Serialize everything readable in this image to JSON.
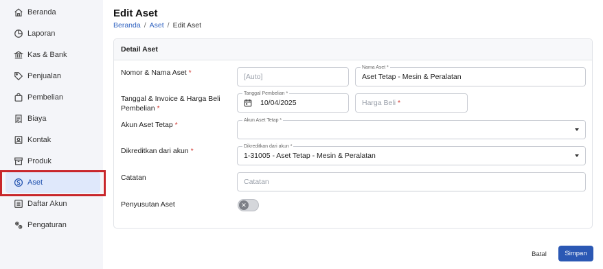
{
  "sidebar": {
    "items": [
      {
        "label": "Beranda",
        "icon": "home-icon"
      },
      {
        "label": "Laporan",
        "icon": "pie-chart-icon"
      },
      {
        "label": "Kas & Bank",
        "icon": "bank-icon"
      },
      {
        "label": "Penjualan",
        "icon": "tag-icon"
      },
      {
        "label": "Pembelian",
        "icon": "shopping-bag-icon"
      },
      {
        "label": "Biaya",
        "icon": "receipt-icon"
      },
      {
        "label": "Kontak",
        "icon": "contact-card-icon"
      },
      {
        "label": "Produk",
        "icon": "box-icon"
      },
      {
        "label": "Aset",
        "icon": "dollar-circle-icon",
        "active": true
      },
      {
        "label": "Daftar Akun",
        "icon": "account-list-icon"
      },
      {
        "label": "Pengaturan",
        "icon": "settings-icon"
      }
    ]
  },
  "header": {
    "title": "Edit Aset",
    "breadcrumb": [
      "Beranda",
      "Aset",
      "Edit Aset"
    ],
    "separator": "/"
  },
  "card": {
    "title": "Detail Aset",
    "rows": {
      "nomor": {
        "label": "Nomor & Nama Aset",
        "required": "*"
      },
      "tanggal": {
        "label_line1": "Tanggal & Invoice & Harga Beli",
        "label_line2": "Pembelian",
        "required": "*"
      },
      "akun": {
        "label": "Akun Aset Tetap",
        "required": "*"
      },
      "kredit": {
        "label": "Dikreditkan dari akun",
        "required": "*"
      },
      "catatan": {
        "label": "Catatan"
      },
      "penyusutan": {
        "label": "Penyusutan Aset"
      }
    },
    "fields": {
      "nomor_placeholder": "[Auto]",
      "nama_float": "Nama Aset *",
      "nama_value": "Aset Tetap - Mesin & Peralatan",
      "tanggal_float": "Tanggal Pembelian *",
      "tanggal_value": "10/04/2025",
      "harga_placeholder": "Harga Beli",
      "harga_required": "*",
      "akun_float": "Akun Aset Tetap *",
      "akun_value": "",
      "kredit_float": "Dikreditkan dari akun *",
      "kredit_value": "1-31005 - Aset Tetap - Mesin & Peralatan",
      "catatan_placeholder": "Catatan",
      "penyusutan_enabled": false
    }
  },
  "actions": {
    "cancel_label": "Batal",
    "save_label": "Simpan"
  },
  "colors": {
    "accent": "#2b58b4",
    "active_bg": "#dfe8fb",
    "highlight_border": "#c8262b",
    "required": "#d0342c"
  }
}
